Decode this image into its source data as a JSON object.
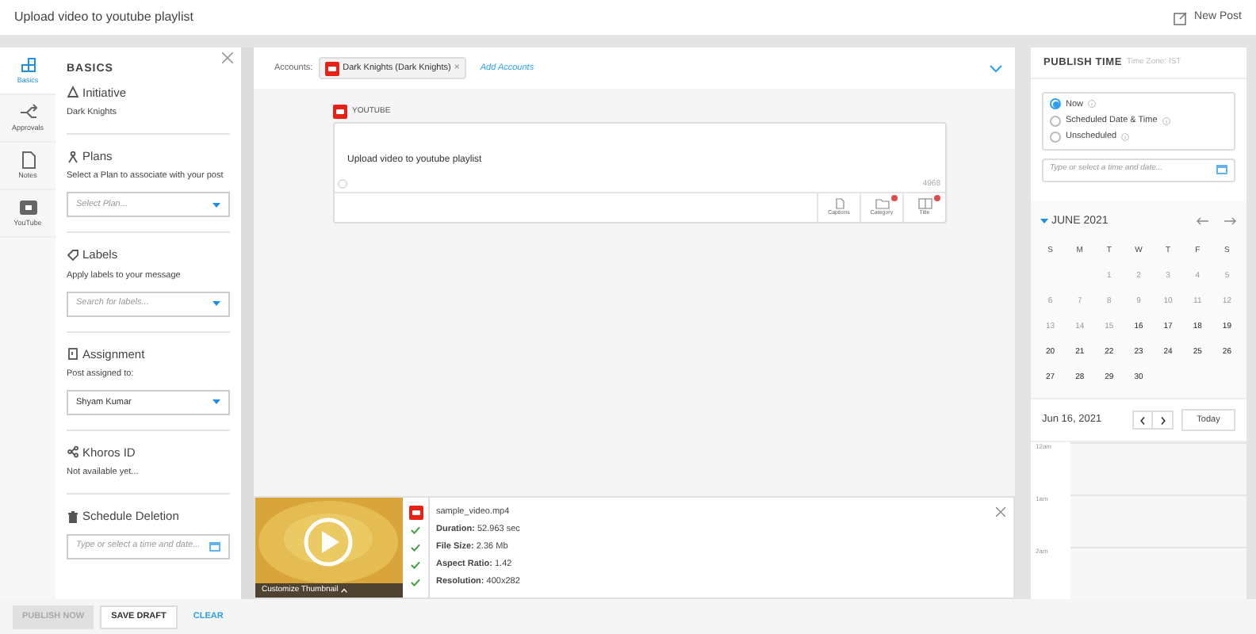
{
  "header": {
    "title": "Upload video to youtube playlist",
    "new_post": "New Post"
  },
  "nav": [
    {
      "label": "Basics",
      "selected": true
    },
    {
      "label": "Approvals",
      "selected": false
    },
    {
      "label": "Notes",
      "selected": false
    },
    {
      "label": "YouTube",
      "selected": false
    }
  ],
  "basics": {
    "title": "BASICS",
    "sections": [
      {
        "title": "Initiative",
        "value": "Dark Knights"
      },
      {
        "title": "Plans",
        "description": "Select a Plan to associate with your post",
        "field": {
          "placeholder": "Select Plan...",
          "kind": "select"
        }
      },
      {
        "title": "Labels",
        "description": "Apply labels to your message",
        "field": {
          "placeholder": "Search for labels...",
          "kind": "select"
        }
      },
      {
        "title": "Assignment",
        "description": "Post assigned to:",
        "field": {
          "value": "Shyam Kumar",
          "kind": "select"
        }
      },
      {
        "title": "Khoros ID",
        "value": "Not available yet..."
      },
      {
        "title": "Schedule Deletion",
        "field": {
          "placeholder": "Type or select a time and date...",
          "kind": "date"
        }
      }
    ]
  },
  "accounts": {
    "label": "Accounts:",
    "chips": [
      {
        "label": "Dark Knights (Dark Knights)",
        "remove": "×"
      }
    ],
    "add": "Add Accounts"
  },
  "composer": {
    "network": "YOUTUBE",
    "text": "Upload video to youtube playlist",
    "count": "4968",
    "tools": [
      {
        "label": "Captions",
        "alert": false
      },
      {
        "label": "Category",
        "alert": true
      },
      {
        "label": "Title",
        "alert": true
      }
    ]
  },
  "video": {
    "thumbnail_action": "Customize Thumbnail",
    "filename": "sample_video.mp4",
    "checks": [
      {
        "label": "Duration:",
        "value": "52.963 sec",
        "checked": true
      },
      {
        "label": "File Size:",
        "value": "2.36 Mb",
        "checked": true
      },
      {
        "label": "Aspect Ratio:",
        "value": "1.42",
        "checked": true
      },
      {
        "label": "Resolution:",
        "value": "400x282",
        "checked": true
      }
    ]
  },
  "publish": {
    "title": "PUBLISH TIME",
    "timezone": "Time Zone: IST",
    "options": [
      {
        "label": "Now",
        "selected": true
      },
      {
        "label": "Scheduled Date & Time",
        "selected": false
      },
      {
        "label": "Unscheduled",
        "selected": false
      }
    ],
    "placeholder": "Type or select a time and date...",
    "month": "JUNE 2021",
    "weekdays": [
      "S",
      "M",
      "T",
      "W",
      "T",
      "F",
      "S"
    ],
    "weeks": [
      [
        {
          "day": "1",
          "disabled": true
        },
        {
          "day": "2",
          "disabled": true
        },
        {
          "day": "3",
          "disabled": true
        },
        {
          "day": "4",
          "disabled": true
        },
        {
          "day": "5",
          "disabled": true
        }
      ],
      [
        {
          "day": "6",
          "disabled": true
        },
        {
          "day": "7",
          "disabled": true
        },
        {
          "day": "8",
          "disabled": true
        },
        {
          "day": "9",
          "disabled": true
        },
        {
          "day": "10",
          "disabled": true
        },
        {
          "day": "11",
          "disabled": true
        },
        {
          "day": "12",
          "disabled": true
        }
      ],
      [
        {
          "day": "13",
          "disabled": true
        },
        {
          "day": "14",
          "disabled": true
        },
        {
          "day": "15",
          "disabled": true
        },
        {
          "day": "16",
          "disabled": false
        },
        {
          "day": "17",
          "disabled": false
        },
        {
          "day": "18",
          "disabled": false
        },
        {
          "day": "19",
          "disabled": false
        }
      ],
      [
        {
          "day": "20",
          "disabled": false
        },
        {
          "day": "21",
          "disabled": false
        },
        {
          "day": "22",
          "disabled": false
        },
        {
          "day": "23",
          "disabled": false
        },
        {
          "day": "24",
          "disabled": false
        },
        {
          "day": "25",
          "disabled": false
        },
        {
          "day": "26",
          "disabled": false
        }
      ],
      [
        {
          "day": "27",
          "disabled": false
        },
        {
          "day": "28",
          "disabled": false
        },
        {
          "day": "29",
          "disabled": false
        },
        {
          "day": "30",
          "disabled": false
        }
      ]
    ],
    "date": "Jun 16, 2021",
    "today": "Today",
    "hours": [
      "12am",
      "1am",
      "2am"
    ]
  },
  "footer": [
    {
      "label": "PUBLISH NOW",
      "kind": "button",
      "disabled": true
    },
    {
      "label": "SAVE DRAFT",
      "kind": "button",
      "disabled": false
    },
    {
      "label": "CLEAR",
      "kind": "link",
      "disabled": false
    }
  ]
}
